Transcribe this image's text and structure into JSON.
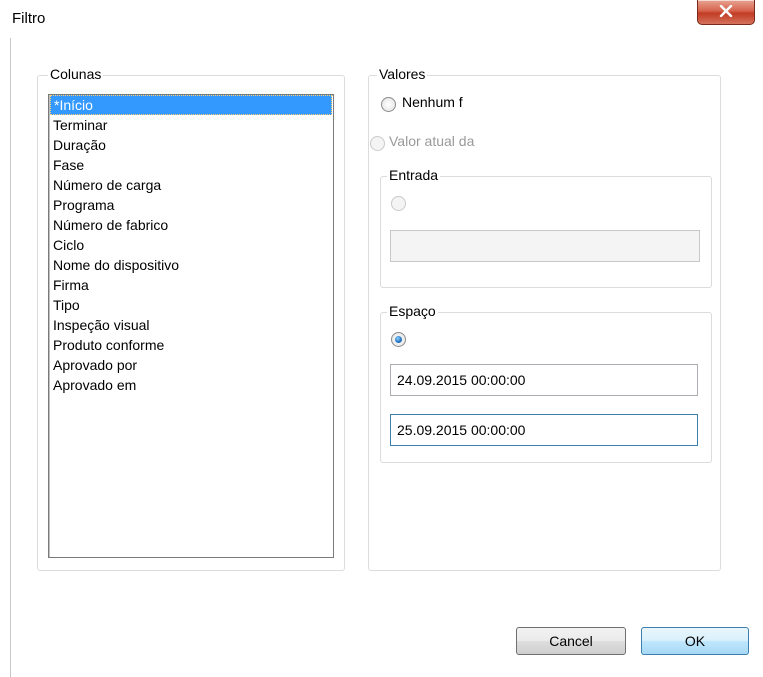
{
  "window": {
    "title": "Filtro",
    "close_glyph": "X"
  },
  "columns": {
    "label": "Colunas",
    "items": [
      "*Início",
      "Terminar",
      "Duração",
      "Fase",
      "Número de carga",
      "Programa",
      "Número de fabrico",
      "Ciclo",
      "Nome do dispositivo",
      "Firma",
      "Tipo",
      "Inspeção visual",
      "Produto conforme",
      "Aprovado por",
      "Aprovado em"
    ],
    "selected_index": 0
  },
  "values": {
    "label": "Valores",
    "none_option": "Nenhum f",
    "current_value_option": "Valor atual da",
    "entry": {
      "label": "Entrada",
      "value": ""
    },
    "range": {
      "label": "Espaço",
      "from": "24.09.2015 00:00:00",
      "to": "25.09.2015 00:00:00"
    }
  },
  "buttons": {
    "cancel": "Cancel",
    "ok": "OK"
  },
  "colors": {
    "selection": "#3399ff",
    "close_button": "#c23c24",
    "focus_border": "#3c7fb1"
  }
}
